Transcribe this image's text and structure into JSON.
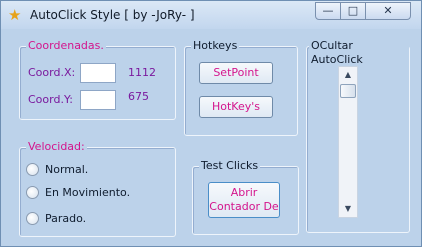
{
  "window": {
    "title": "AutoClick Style [ by -JoRy- ]",
    "app_icon": "star-icon"
  },
  "controls": {
    "minimize": "—",
    "maximize": "□",
    "close": "✕"
  },
  "coordenadas": {
    "title": "Coordenadas.",
    "x_label": "Coord.X:",
    "x_input": "",
    "x_value": "1112",
    "y_label": "Coord.Y:",
    "y_input": "",
    "y_value": "675"
  },
  "hotkeys": {
    "title": "Hotkeys",
    "setpoint_button": "SetPoint",
    "hotkeys_button": "HotKey's"
  },
  "ocultar": {
    "title": "OCultar AutoClick"
  },
  "velocidad": {
    "title": "Velocidad:",
    "options": [
      "Normal.",
      "En Movimiento.",
      "Parado."
    ]
  },
  "test_clicks": {
    "title": "Test Clicks",
    "button_line1": "Abrir",
    "button_line2": "Contador De"
  },
  "colors": {
    "accent": "#d4148c",
    "value": "#7a1a9e",
    "window_bg": "#bcd2ea"
  }
}
